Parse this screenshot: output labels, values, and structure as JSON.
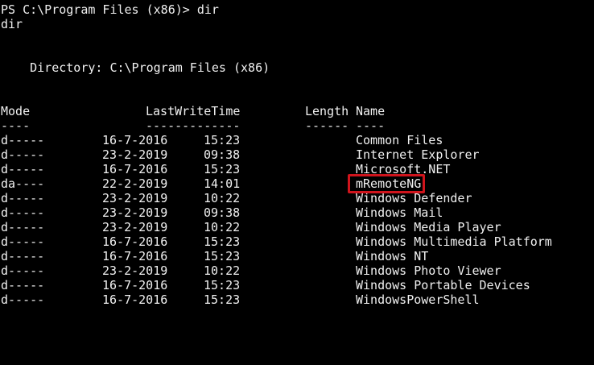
{
  "terminal": {
    "prompt_line": "PS C:\\Program Files (x86)> dir",
    "echo_line": "dir",
    "directory_line": "    Directory: C:\\Program Files (x86)",
    "headers": {
      "mode": "Mode",
      "last_write_time": "LastWriteTime",
      "length": "Length",
      "name": "Name"
    },
    "underlines": {
      "mode": "----",
      "last_write_time": "-------------",
      "length": "------",
      "name": "----"
    },
    "rows": [
      {
        "mode": "d-----",
        "date": "16-7-2016",
        "time": "15:23",
        "length": "",
        "name": "Common Files"
      },
      {
        "mode": "d-----",
        "date": "23-2-2019",
        "time": "09:38",
        "length": "",
        "name": "Internet Explorer"
      },
      {
        "mode": "d-----",
        "date": "16-7-2016",
        "time": "15:23",
        "length": "",
        "name": "Microsoft.NET"
      },
      {
        "mode": "da----",
        "date": "22-2-2019",
        "time": "14:01",
        "length": "",
        "name": "mRemoteNG"
      },
      {
        "mode": "d-----",
        "date": "23-2-2019",
        "time": "10:22",
        "length": "",
        "name": "Windows Defender"
      },
      {
        "mode": "d-----",
        "date": "23-2-2019",
        "time": "09:38",
        "length": "",
        "name": "Windows Mail"
      },
      {
        "mode": "d-----",
        "date": "23-2-2019",
        "time": "10:22",
        "length": "",
        "name": "Windows Media Player"
      },
      {
        "mode": "d-----",
        "date": "16-7-2016",
        "time": "15:23",
        "length": "",
        "name": "Windows Multimedia Platform"
      },
      {
        "mode": "d-----",
        "date": "16-7-2016",
        "time": "15:23",
        "length": "",
        "name": "Windows NT"
      },
      {
        "mode": "d-----",
        "date": "23-2-2019",
        "time": "10:22",
        "length": "",
        "name": "Windows Photo Viewer"
      },
      {
        "mode": "d-----",
        "date": "16-7-2016",
        "time": "15:23",
        "length": "",
        "name": "Windows Portable Devices"
      },
      {
        "mode": "d-----",
        "date": "16-7-2016",
        "time": "15:23",
        "length": "",
        "name": "WindowsPowerShell"
      }
    ]
  },
  "colors": {
    "background": "#000000",
    "text": "#f0f0f0",
    "highlight_border": "#d0141c"
  }
}
